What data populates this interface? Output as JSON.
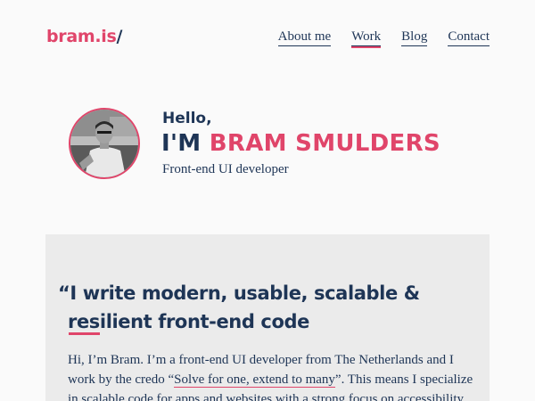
{
  "header": {
    "logo_main": "bram.is",
    "logo_slash": "/",
    "nav": [
      "About me",
      "Work",
      "Blog",
      "Contact"
    ]
  },
  "intro": {
    "hello": "Hello,",
    "name_prefix": "I'M",
    "name": "BRAM SMULDERS",
    "role": "Front-end UI developer"
  },
  "card": {
    "quote_line1": "“I write modern, usable, scalable &",
    "quote_line2": "resilient front-end code",
    "body_before": "Hi, I’m Bram. I’m a front-end UI developer from The Netherlands and I work by the credo “",
    "body_link": "Solve for one, extend to many",
    "body_after": "”. This means I specialize in scalable code for apps and websites with a strong focus on accessibility."
  },
  "colors": {
    "accent": "#e0456a",
    "navy": "#1e3556",
    "background": "#fafafa",
    "card": "#ebebeb"
  }
}
